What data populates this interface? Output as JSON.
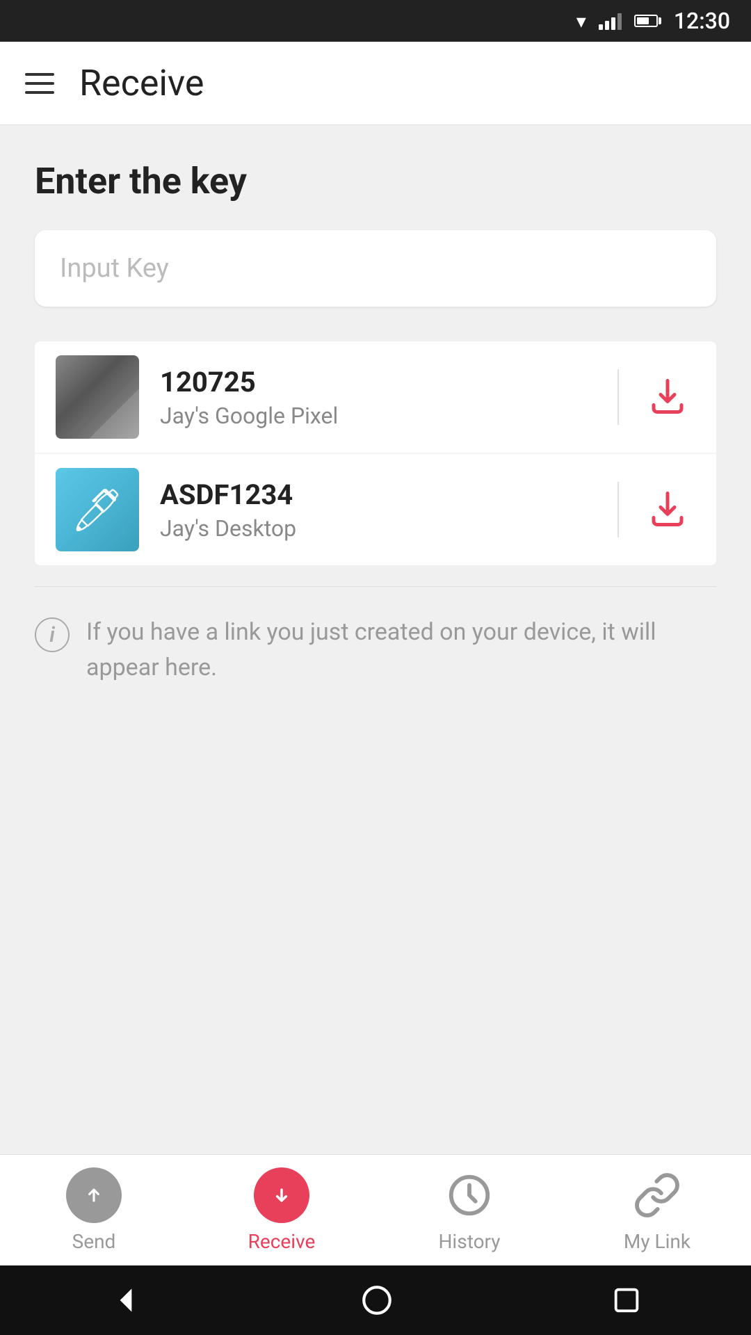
{
  "statusBar": {
    "time": "12:30"
  },
  "appBar": {
    "title": "Receive"
  },
  "mainSection": {
    "heading": "Enter the key",
    "inputPlaceholder": "Input Key"
  },
  "devices": [
    {
      "key": "120725",
      "name": "Jay's Google Pixel",
      "thumbnailType": "pixel"
    },
    {
      "key": "ASDF1234",
      "name": "Jay's Desktop",
      "thumbnailType": "desktop"
    }
  ],
  "infoNote": {
    "text": "If you have a link you just created on your device, it will appear here."
  },
  "bottomNav": {
    "items": [
      {
        "id": "send",
        "label": "Send",
        "icon": "upload",
        "active": false
      },
      {
        "id": "receive",
        "label": "Receive",
        "icon": "download",
        "active": true
      },
      {
        "id": "history",
        "label": "History",
        "icon": "clock",
        "active": false
      },
      {
        "id": "mylink",
        "label": "My Link",
        "icon": "link",
        "active": false
      }
    ]
  },
  "colors": {
    "accent": "#e8405a",
    "gray": "#999999"
  }
}
